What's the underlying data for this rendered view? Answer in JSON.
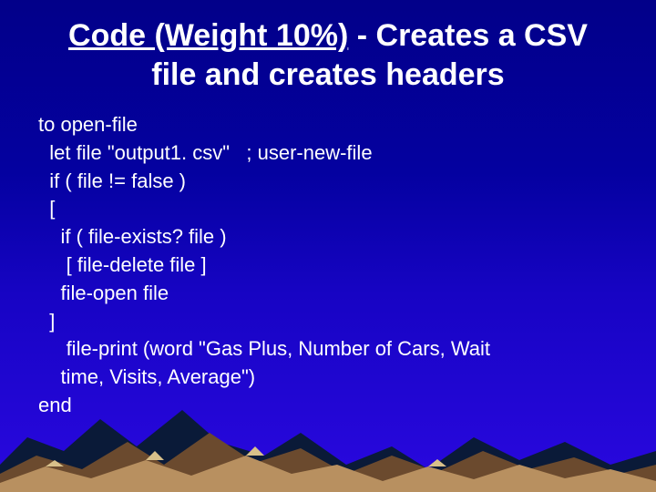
{
  "title": {
    "underlined": "Code (Weight 10%)",
    "rest": " - Creates a CSV file and creates headers"
  },
  "code": {
    "l1": "to open-file",
    "l2": "  let file \"output1. csv\"   ; user-new-file",
    "l3": "  if ( file != false )",
    "l4": "  [",
    "l5": "    if ( file-exists? file )",
    "l6": "     [ file-delete file ]",
    "l7": "    file-open file",
    "l8": "  ]",
    "l9": "     file-print (word \"Gas Plus, Number of Cars, Wait",
    "l10": "    time, Visits, Average\")",
    "l11": "end"
  }
}
